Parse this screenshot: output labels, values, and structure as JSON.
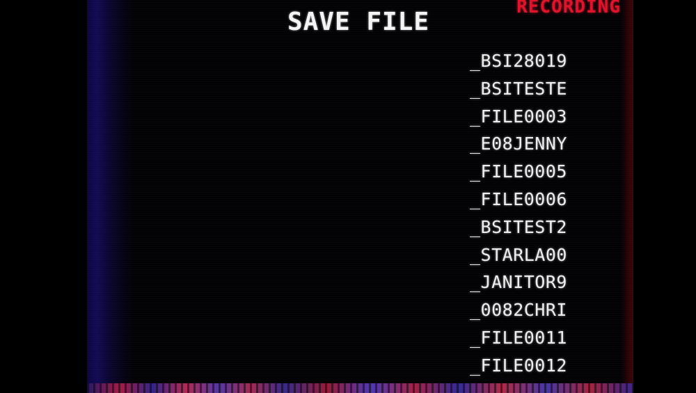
{
  "screen": {
    "title": "SAVE FILE",
    "status": "RECORDING",
    "status_color": "#e0122a"
  },
  "files": [
    "_BSI28019",
    "_BSITESTE",
    "_FILE0003",
    "_E08JENNY",
    "_FILE0005",
    "_FILE0006",
    "_BSITEST2",
    "_STARLA00",
    "_JANITOR9",
    "_0082CHRI",
    "_FILE0011",
    "_FILE0012"
  ]
}
